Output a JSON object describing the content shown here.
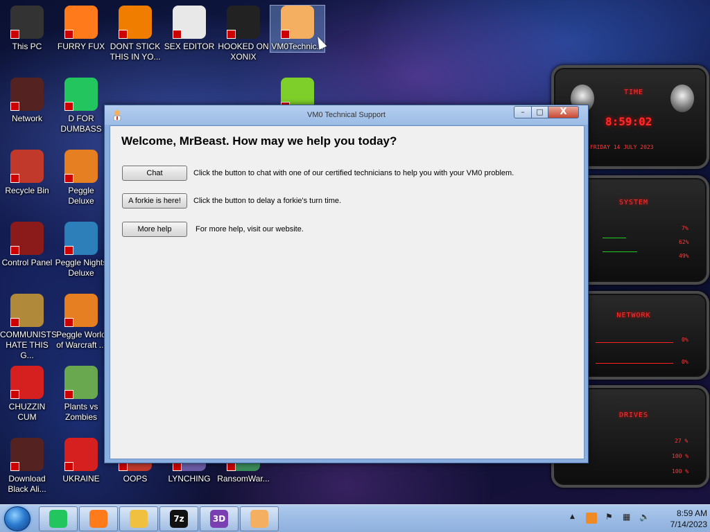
{
  "desktop_icons": [
    {
      "label": "This PC",
      "icon": "computer-icon",
      "color": "#333333"
    },
    {
      "label": "FURRY FUX",
      "icon": "firefox-icon",
      "color": "#ff7a1a"
    },
    {
      "label": "DONT STICK THIS IN YO...",
      "icon": "vlc-cone-icon",
      "color": "#f07d00"
    },
    {
      "label": "SEX EDITOR",
      "icon": "hxd-editor-icon",
      "color": "#e8e8e8"
    },
    {
      "label": "HOOKED ON XONIX",
      "icon": "xonix-game-icon",
      "color": "#222222"
    },
    {
      "label": "VM0Technic...",
      "icon": "technician-icon",
      "color": "#f4b060"
    },
    {
      "label": "Network",
      "icon": "network-icon",
      "color": "#552222"
    },
    {
      "label": "D FOR DUMBASS",
      "icon": "chat-bubble-icon",
      "color": "#22c55e"
    },
    {
      "label": "Recycle Bin",
      "icon": "recycle-bin-icon",
      "color": "#c0392b"
    },
    {
      "label": "Peggle Deluxe",
      "icon": "peggle-icon",
      "color": "#e67e22"
    },
    {
      "label": "Control Panel",
      "icon": "control-panel-icon",
      "color": "#8b1a1a"
    },
    {
      "label": "Peggle Nights Deluxe",
      "icon": "peggle-nights-icon",
      "color": "#2c7fb8"
    },
    {
      "label": "COMMUNISTS HATE THIS G...",
      "icon": "money-bag-icon",
      "color": "#b08a3a"
    },
    {
      "label": "Peggle World of Warcraft ...",
      "icon": "peggle-wow-icon",
      "color": "#e67e22"
    },
    {
      "label": "CHUZZIN CUM",
      "icon": "chuzzle-icon",
      "color": "#d62020"
    },
    {
      "label": "Plants vs Zombies",
      "icon": "flower-icon",
      "color": "#6aa84f"
    },
    {
      "label": "Download Black Ali...",
      "icon": "alien-theme-icon",
      "color": "#552222"
    },
    {
      "label": "UKRAINE",
      "icon": "radiation-icon",
      "color": "#d62020"
    },
    {
      "label": "OOPS",
      "icon": "dev-cpp-icon",
      "color": "#c0392b"
    },
    {
      "label": "LYNCHING",
      "icon": "window-app-icon",
      "color": "#6b5ca5"
    },
    {
      "label": "RansomWar...",
      "icon": "santa-icon",
      "color": "#3b8b5a"
    },
    {
      "label": "",
      "icon": "lime-icon",
      "color": "#7fcf2a"
    }
  ],
  "window": {
    "title": "VM0 Technical Support",
    "welcome": "Welcome, MrBeast. How may we help you today?",
    "rows": [
      {
        "button": "Chat",
        "text": "Click the button to chat with one of our certified technicians to help you with your VM0 problem."
      },
      {
        "button": "A forkie is here!",
        "text": "Click the button to delay a forkie's turn time."
      },
      {
        "button": "More help",
        "text": "For more help, visit our website."
      }
    ],
    "controls": {
      "minimize": "–",
      "maximize": "□",
      "close": "X"
    }
  },
  "gadget": {
    "time_title": "TIME",
    "time": "8:59:02",
    "date": "FRIDAY 14 JULY 2023",
    "system_title": "SYSTEM",
    "system_values": [
      "7%",
      "62%",
      "49%"
    ],
    "network_title": "NETWORK",
    "network_values": [
      "0%",
      "0%"
    ],
    "drives_title": "DRIVES",
    "drives_values": [
      "27 %",
      "100 %",
      "100 %"
    ]
  },
  "taskbar": {
    "pinned": [
      {
        "icon": "chat-bubble-icon",
        "color": "#22c55e",
        "glyph": ""
      },
      {
        "icon": "firefox-icon",
        "color": "#ff7a1a",
        "glyph": ""
      },
      {
        "icon": "file-explorer-icon",
        "color": "#f0c040",
        "glyph": ""
      },
      {
        "icon": "7zip-icon",
        "color": "#111111",
        "glyph": "7z"
      },
      {
        "icon": "3d-builder-icon",
        "color": "#7a3fb0",
        "glyph": "3D"
      },
      {
        "icon": "technician-icon",
        "color": "#f4b060",
        "glyph": ""
      }
    ],
    "time": "8:59 AM",
    "date": "7/14/2023"
  }
}
